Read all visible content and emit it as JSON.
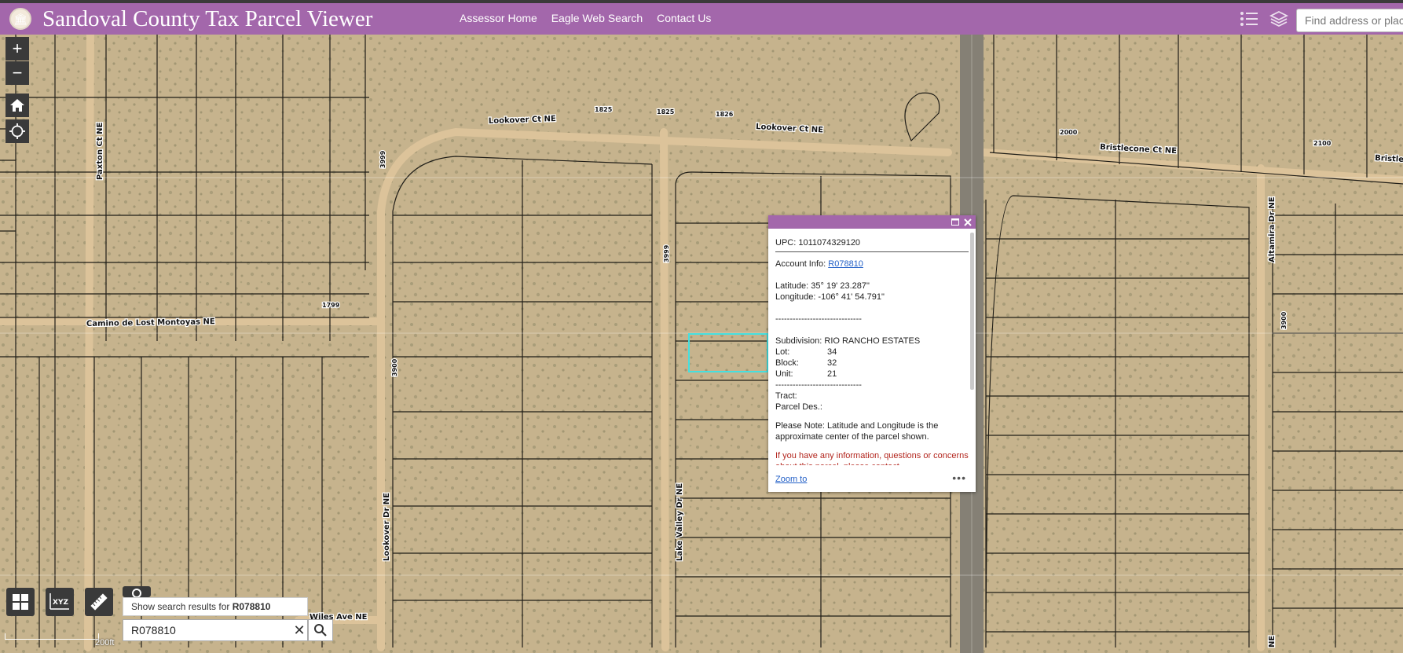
{
  "header": {
    "title": "Sandoval County Tax Parcel Viewer",
    "nav": [
      "Assessor Home",
      "Eagle Web Search",
      "Contact Us"
    ],
    "search_placeholder": "Find address or plac",
    "colors": {
      "header_bg": "#a367ab",
      "popup_bar": "#a367ab",
      "selection": "#45e0e0"
    },
    "icons": [
      "legend-icon",
      "layers-icon"
    ]
  },
  "map": {
    "streets": [
      "Lookover Ct NE",
      "Lookover Ct NE",
      "Bristlecone Ct NE",
      "Bristle",
      "Paxton Ct NE",
      "Camino de Lost Montoyas NE",
      "Lookover Dr NE",
      "Lake Valley Dr NE",
      "Altamira Dr NE",
      "Wiles Ave NE",
      "NE"
    ],
    "numbers": [
      "1825",
      "1825",
      "1826",
      "2000",
      "2100",
      "3999",
      "3999",
      "3900",
      "1799",
      "3900"
    ],
    "controls": {
      "zoom_in": "+",
      "zoom_out": "−"
    }
  },
  "popup": {
    "upc": "UPC: 1011074329120",
    "account_label": "Account Info: ",
    "account_link": "R078810",
    "latitude": "Latitude: 35° 19' 23.287\"",
    "longitude": "Longitude: -106° 41' 54.791\"",
    "divider": "------------------------------",
    "subdivision": "Subdivision: RIO RANCHO ESTATES",
    "lot_label": "Lot:",
    "lot": "34",
    "block_label": "Block:",
    "block": "32",
    "unit_label": "Unit:",
    "unit": "21",
    "tract": "Tract:",
    "parcel_des": "Parcel Des.:",
    "note": "Please Note: Latitude and Longitude is the approximate center of the parcel shown.",
    "info": "If you have any information, questions or concerns about this parcel, please contact",
    "zoom_to": "Zoom to",
    "more": "•••"
  },
  "toolbar": {
    "xyz": "XYZ",
    "suggestion_prefix": "Show search results for ",
    "suggestion_value": "R078810",
    "search_value": "R078810",
    "clear": "✕"
  },
  "scale": {
    "label": "200ft"
  }
}
